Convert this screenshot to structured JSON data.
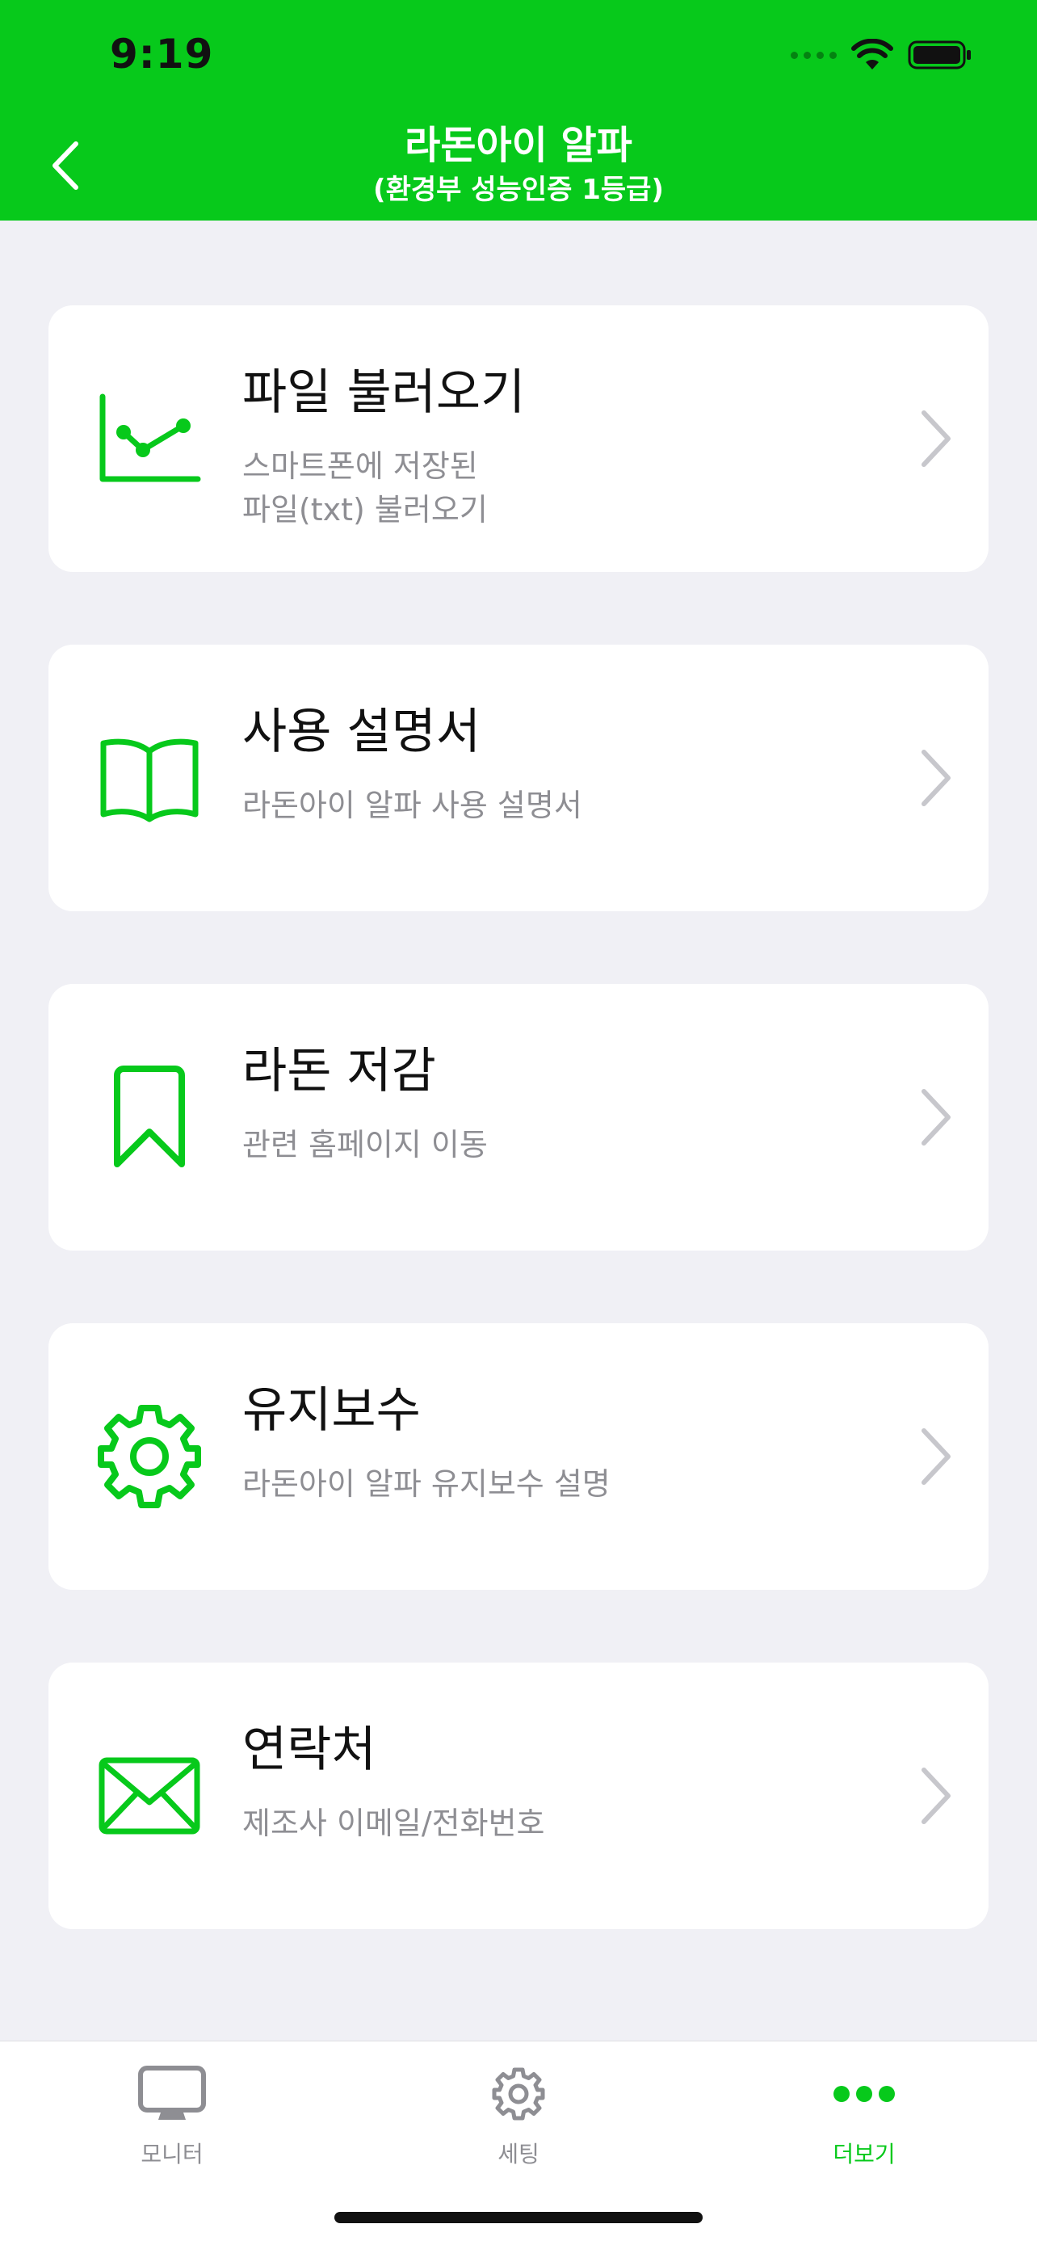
{
  "status_bar": {
    "time": "9:19"
  },
  "nav": {
    "title": "라돈아이 알파",
    "subtitle": "(환경부 성능인증 1등급)"
  },
  "colors": {
    "accent": "#07c91b",
    "background": "#f0f0f5",
    "card": "#ffffff",
    "secondary_text": "#8e8e93",
    "chevron": "#c7c7cc"
  },
  "menu": [
    {
      "title": "파일 불러오기",
      "desc": "스마트폰에 저장된\n파일(txt) 불러오기",
      "icon": "line-chart-icon"
    },
    {
      "title": "사용 설명서",
      "desc": "라돈아이 알파 사용 설명서",
      "icon": "open-book-icon"
    },
    {
      "title": "라돈 저감",
      "desc": "관련 홈페이지 이동",
      "icon": "bookmark-icon"
    },
    {
      "title": "유지보수",
      "desc": "라돈아이 알파 유지보수 설명",
      "icon": "gear-icon"
    },
    {
      "title": "연락처",
      "desc": "제조사 이메일/전화번호",
      "icon": "envelope-icon"
    }
  ],
  "tabs": [
    {
      "label": "모니터",
      "icon": "monitor-icon",
      "active": false
    },
    {
      "label": "세팅",
      "icon": "gear-icon",
      "active": false
    },
    {
      "label": "더보기",
      "icon": "more-dots-icon",
      "active": true
    }
  ]
}
